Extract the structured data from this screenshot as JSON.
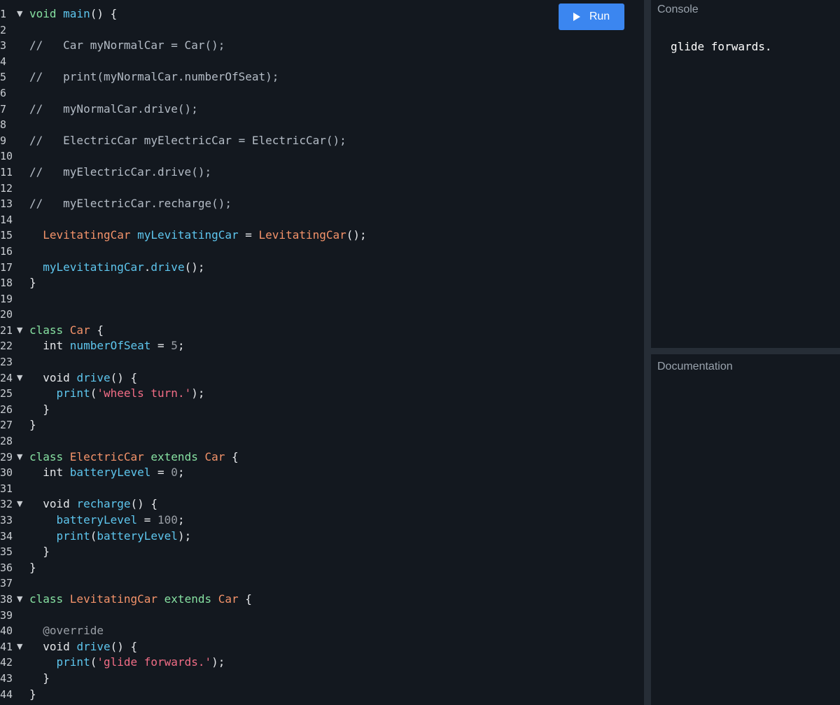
{
  "toolbar": {
    "run_label": "Run"
  },
  "console": {
    "title": "Console",
    "output": "glide forwards."
  },
  "documentation": {
    "title": "Documentation"
  },
  "code_lines": [
    {
      "n": "1",
      "fold": true,
      "tokens": [
        [
          "kw",
          "void "
        ],
        [
          "fn",
          "main"
        ],
        [
          "plain",
          "() {"
        ]
      ]
    },
    {
      "n": "2",
      "tokens": []
    },
    {
      "n": "3",
      "tokens": [
        [
          "comment",
          "//   Car myNormalCar = Car();"
        ]
      ]
    },
    {
      "n": "4",
      "tokens": []
    },
    {
      "n": "5",
      "tokens": [
        [
          "comment",
          "//   print(myNormalCar.numberOfSeat);"
        ]
      ]
    },
    {
      "n": "6",
      "tokens": []
    },
    {
      "n": "7",
      "tokens": [
        [
          "comment",
          "//   myNormalCar.drive();"
        ]
      ]
    },
    {
      "n": "8",
      "tokens": []
    },
    {
      "n": "9",
      "tokens": [
        [
          "comment",
          "//   ElectricCar myElectricCar = ElectricCar();"
        ]
      ]
    },
    {
      "n": "10",
      "tokens": []
    },
    {
      "n": "11",
      "tokens": [
        [
          "comment",
          "//   myElectricCar.drive();"
        ]
      ]
    },
    {
      "n": "12",
      "tokens": []
    },
    {
      "n": "13",
      "tokens": [
        [
          "comment",
          "//   myElectricCar.recharge();"
        ]
      ]
    },
    {
      "n": "14",
      "tokens": []
    },
    {
      "n": "15",
      "tokens": [
        [
          "plain",
          "  "
        ],
        [
          "type",
          "LevitatingCar "
        ],
        [
          "fn",
          "myLevitatingCar"
        ],
        [
          "plain",
          " = "
        ],
        [
          "type",
          "LevitatingCar"
        ],
        [
          "plain",
          "();"
        ]
      ]
    },
    {
      "n": "16",
      "tokens": []
    },
    {
      "n": "17",
      "tokens": [
        [
          "plain",
          "  "
        ],
        [
          "fn",
          "myLevitatingCar"
        ],
        [
          "plain",
          "."
        ],
        [
          "fn",
          "drive"
        ],
        [
          "plain",
          "();"
        ]
      ]
    },
    {
      "n": "18",
      "tokens": [
        [
          "plain",
          "}"
        ]
      ]
    },
    {
      "n": "19",
      "tokens": []
    },
    {
      "n": "20",
      "tokens": []
    },
    {
      "n": "21",
      "fold": true,
      "tokens": [
        [
          "kw",
          "class "
        ],
        [
          "type",
          "Car"
        ],
        [
          "plain",
          " {"
        ]
      ]
    },
    {
      "n": "22",
      "tokens": [
        [
          "plain",
          "  int "
        ],
        [
          "fn",
          "numberOfSeat"
        ],
        [
          "plain",
          " = "
        ],
        [
          "num",
          "5"
        ],
        [
          "plain",
          ";"
        ]
      ]
    },
    {
      "n": "23",
      "tokens": []
    },
    {
      "n": "24",
      "fold": true,
      "tokens": [
        [
          "plain",
          "  void "
        ],
        [
          "fn",
          "drive"
        ],
        [
          "plain",
          "() {"
        ]
      ]
    },
    {
      "n": "25",
      "tokens": [
        [
          "plain",
          "    "
        ],
        [
          "fn",
          "print"
        ],
        [
          "plain",
          "("
        ],
        [
          "string",
          "'wheels turn.'"
        ],
        [
          "plain",
          ");"
        ]
      ]
    },
    {
      "n": "26",
      "tokens": [
        [
          "plain",
          "  }"
        ]
      ]
    },
    {
      "n": "27",
      "tokens": [
        [
          "plain",
          "}"
        ]
      ]
    },
    {
      "n": "28",
      "tokens": []
    },
    {
      "n": "29",
      "fold": true,
      "tokens": [
        [
          "kw",
          "class "
        ],
        [
          "type",
          "ElectricCar"
        ],
        [
          "kw",
          " extends "
        ],
        [
          "type",
          "Car"
        ],
        [
          "plain",
          " {"
        ]
      ]
    },
    {
      "n": "30",
      "tokens": [
        [
          "plain",
          "  int "
        ],
        [
          "fn",
          "batteryLevel"
        ],
        [
          "plain",
          " = "
        ],
        [
          "num",
          "0"
        ],
        [
          "plain",
          ";"
        ]
      ]
    },
    {
      "n": "31",
      "tokens": []
    },
    {
      "n": "32",
      "fold": true,
      "tokens": [
        [
          "plain",
          "  void "
        ],
        [
          "fn",
          "recharge"
        ],
        [
          "plain",
          "() {"
        ]
      ]
    },
    {
      "n": "33",
      "tokens": [
        [
          "plain",
          "    "
        ],
        [
          "fn",
          "batteryLevel"
        ],
        [
          "plain",
          " = "
        ],
        [
          "num",
          "100"
        ],
        [
          "plain",
          ";"
        ]
      ]
    },
    {
      "n": "34",
      "tokens": [
        [
          "plain",
          "    "
        ],
        [
          "fn",
          "print"
        ],
        [
          "plain",
          "("
        ],
        [
          "fn",
          "batteryLevel"
        ],
        [
          "plain",
          ");"
        ]
      ]
    },
    {
      "n": "35",
      "tokens": [
        [
          "plain",
          "  }"
        ]
      ]
    },
    {
      "n": "36",
      "tokens": [
        [
          "plain",
          "}"
        ]
      ]
    },
    {
      "n": "37",
      "tokens": []
    },
    {
      "n": "38",
      "fold": true,
      "tokens": [
        [
          "kw",
          "class "
        ],
        [
          "type",
          "LevitatingCar"
        ],
        [
          "kw",
          " extends "
        ],
        [
          "type",
          "Car"
        ],
        [
          "plain",
          " {"
        ]
      ]
    },
    {
      "n": "39",
      "tokens": []
    },
    {
      "n": "40",
      "tokens": [
        [
          "plain",
          "  "
        ],
        [
          "ann",
          "@override"
        ]
      ]
    },
    {
      "n": "41",
      "fold": true,
      "tokens": [
        [
          "plain",
          "  void "
        ],
        [
          "fn",
          "drive"
        ],
        [
          "plain",
          "() {"
        ]
      ]
    },
    {
      "n": "42",
      "tokens": [
        [
          "plain",
          "    "
        ],
        [
          "fn",
          "print"
        ],
        [
          "plain",
          "("
        ],
        [
          "string",
          "'glide forwards.'"
        ],
        [
          "plain",
          ");"
        ]
      ]
    },
    {
      "n": "43",
      "tokens": [
        [
          "plain",
          "  }"
        ]
      ]
    },
    {
      "n": "44",
      "tokens": [
        [
          "plain",
          "}"
        ]
      ]
    }
  ]
}
